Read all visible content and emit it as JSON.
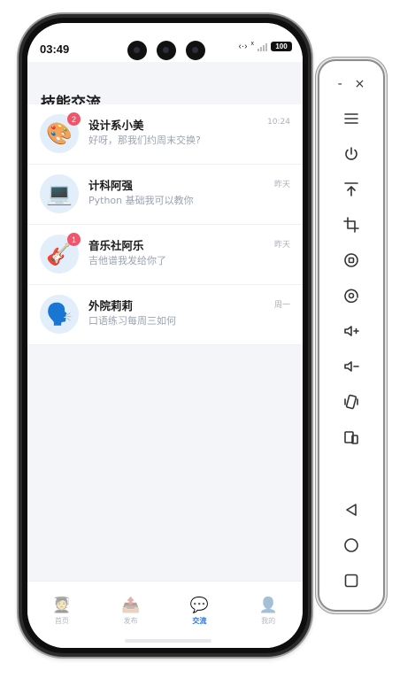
{
  "status_bar": {
    "time": "03:49",
    "network": "‹·›",
    "network_x": "x",
    "battery": "100"
  },
  "page": {
    "title": "技能交流"
  },
  "chats": [
    {
      "name": "设计系小美",
      "message": "好呀，那我们约周末交换?",
      "time": "10:24",
      "avatar_icon": "palette-icon",
      "avatar": "🎨",
      "unread": "2"
    },
    {
      "name": "计科阿强",
      "message": "Python 基础我可以教你",
      "time": "昨天",
      "avatar_icon": "laptop-icon",
      "avatar": "💻",
      "unread": ""
    },
    {
      "name": "音乐社阿乐",
      "message": "吉他谱我发给你了",
      "time": "昨天",
      "avatar_icon": "guitar-icon",
      "avatar": "🎸",
      "unread": "1"
    },
    {
      "name": "外院莉莉",
      "message": "口语练习每周三如何",
      "time": "周一",
      "avatar_icon": "speaking-head-icon",
      "avatar": "🗣️",
      "unread": ""
    }
  ],
  "tabs": [
    {
      "label": "首页",
      "icon": "🧑‍🎓",
      "icon_name": "student-icon",
      "active": false
    },
    {
      "label": "发布",
      "icon": "📤",
      "icon_name": "outbox-icon",
      "active": false
    },
    {
      "label": "交流",
      "icon": "💬",
      "icon_name": "chat-bubble-icon",
      "active": true
    },
    {
      "label": "我的",
      "icon": "👤",
      "icon_name": "person-icon",
      "active": false
    }
  ],
  "toolbar": {
    "minimize": "-",
    "close": "×",
    "buttons": [
      "menu-icon",
      "power-icon",
      "pin-top-icon",
      "crop-icon",
      "rotate-icon",
      "screen-record-icon",
      "volume-up-icon",
      "volume-down-icon",
      "shake-icon",
      "fold-icon",
      "back-icon",
      "home-icon",
      "recents-icon"
    ]
  },
  "colors": {
    "accent": "#2f6fe0",
    "badge": "#f2556a",
    "background": "#f3f5f9"
  }
}
